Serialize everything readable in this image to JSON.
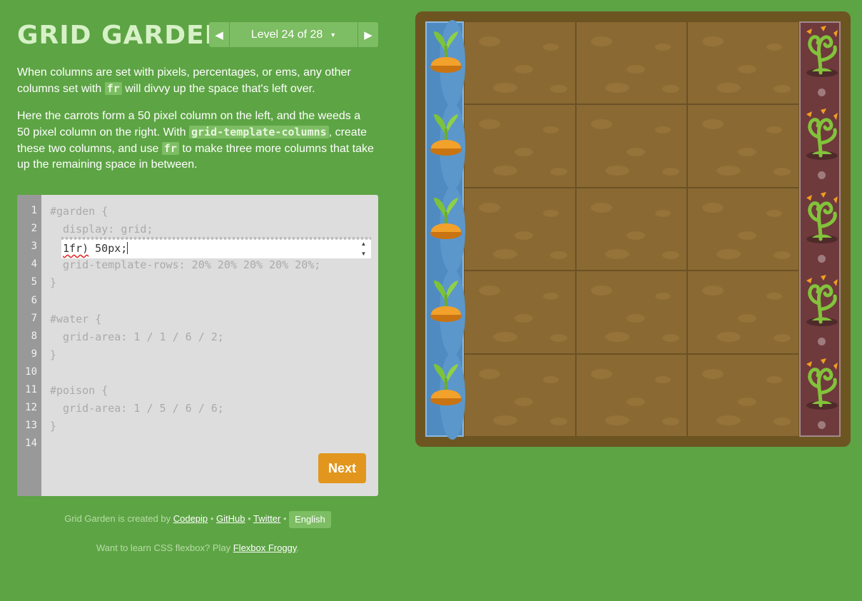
{
  "header": {
    "title": "GRID GARDEN",
    "prev_arrow": "◀",
    "next_arrow": "▶",
    "level_label": "Level 24 of 28",
    "caret": "▼"
  },
  "instructions": {
    "p1_a": "When columns are set with pixels, percentages, or ems, any other columns set with",
    "p1_code": "fr",
    "p1_b": "will divvy up the space that's left over.",
    "p2_a": "Here the carrots form a 50 pixel column on the left, and the weeds a 50 pixel column on the right. With",
    "p2_code1": "grid-template-columns",
    "p2_b": ", create these two columns, and use",
    "p2_code2": "fr",
    "p2_c": "to make three more columns that take up the remaining space in between."
  },
  "editor": {
    "line_numbers": [
      "1",
      "2",
      "3",
      "4",
      "5",
      "6",
      "7",
      "8",
      "9",
      "10",
      "11",
      "12",
      "13",
      "14"
    ],
    "lines": [
      "#garden {",
      "  display: grid;",
      "",
      "  grid-template-rows: 20% 20% 20% 20% 20%;",
      "}",
      "",
      "#water {",
      "  grid-area: 1 / 1 / 6 / 2;",
      "}",
      "",
      "#poison {",
      "  grid-area: 1 / 5 / 6 / 6;",
      "}",
      ""
    ],
    "input_value_word": "1fr)",
    "input_value_rest": " 50px;",
    "spin_up": "▲",
    "spin_down": "▼",
    "next_label": "Next"
  },
  "footer": {
    "credit_prefix": "Grid Garden is created by",
    "link_codepip": "Codepip",
    "sep": "•",
    "link_github": "GitHub",
    "link_twitter": "Twitter",
    "language": "English",
    "promo_prefix": "Want to learn CSS flexbox? Play",
    "promo_link": "Flexbox Froggy",
    "promo_suffix": "."
  },
  "garden": {
    "columns": 5,
    "rows": 5,
    "carrot_icon": "carrot-icon",
    "weed_icon": "weed-icon"
  },
  "colors": {
    "background": "#5da444",
    "soil": "#8a6a32",
    "frame": "#6d5522",
    "water": "#4f8bc1",
    "poison": "#6f3a3c",
    "next_button": "#e2961d"
  }
}
